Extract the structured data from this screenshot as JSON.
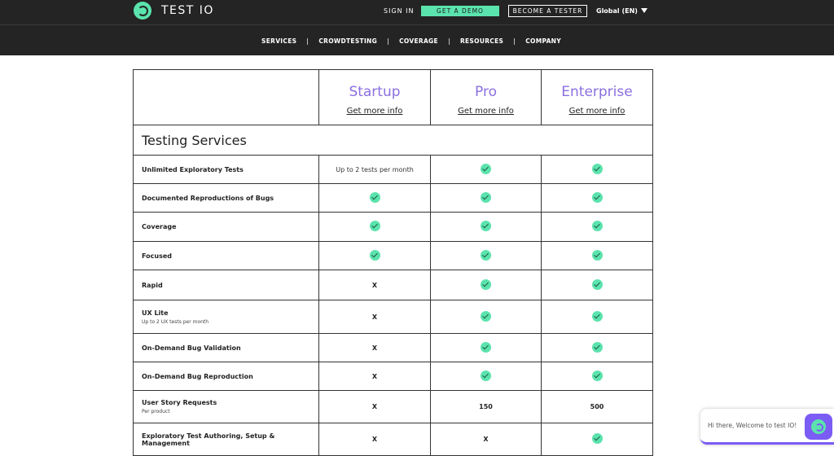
{
  "header": {
    "brand": "TEST IO",
    "signin": "SIGN IN",
    "demo": "GET A DEMO",
    "tester": "BECOME A TESTER",
    "locale": "Global (EN)"
  },
  "nav": {
    "items": [
      "SERVICES",
      "CROWDTESTING",
      "COVERAGE",
      "RESOURCES",
      "COMPANY"
    ]
  },
  "table": {
    "plans": [
      {
        "name": "Startup",
        "link": "Get more info"
      },
      {
        "name": "Pro",
        "link": "Get more info"
      },
      {
        "name": "Enterprise",
        "link": "Get more info"
      }
    ],
    "section_title": "Testing Services",
    "rows": [
      {
        "label": "Unlimited Exploratory Tests",
        "sub": "",
        "cells": [
          "Up to 2 tests per month",
          "check",
          "check"
        ]
      },
      {
        "label": "Documented Reproductions of Bugs",
        "sub": "",
        "cells": [
          "check",
          "check",
          "check"
        ]
      },
      {
        "label": "Coverage",
        "sub": "",
        "cells": [
          "check",
          "check",
          "check"
        ]
      },
      {
        "label": "Focused",
        "sub": "",
        "cells": [
          "check",
          "check",
          "check"
        ]
      },
      {
        "label": "Rapid",
        "sub": "",
        "cells": [
          "X",
          "check",
          "check"
        ]
      },
      {
        "label": "UX Lite",
        "sub": "Up to 2 UX tests per month",
        "cells": [
          "X",
          "check",
          "check"
        ]
      },
      {
        "label": "On-Demand Bug Validation",
        "sub": "",
        "cells": [
          "X",
          "check",
          "check"
        ]
      },
      {
        "label": "On-Demand Bug Reproduction",
        "sub": "",
        "cells": [
          "X",
          "check",
          "check"
        ]
      },
      {
        "label": "User Story Requests",
        "sub": "Per product",
        "cells": [
          "X",
          "150",
          "500"
        ]
      },
      {
        "label": "Exploratory Test Authoring, Setup & Management",
        "sub": "",
        "cells": [
          "X",
          "X",
          "check"
        ]
      }
    ]
  },
  "chat": {
    "greeting": "Hi there, Welcome to test IO!"
  },
  "colors": {
    "accent_green": "#5be3ad",
    "accent_purple": "#8a6fe0",
    "header_bg": "#242424"
  },
  "icons": {
    "logo": "testio-logo-icon",
    "check": "check-circle-icon",
    "chat": "chat-bubble-icon"
  }
}
